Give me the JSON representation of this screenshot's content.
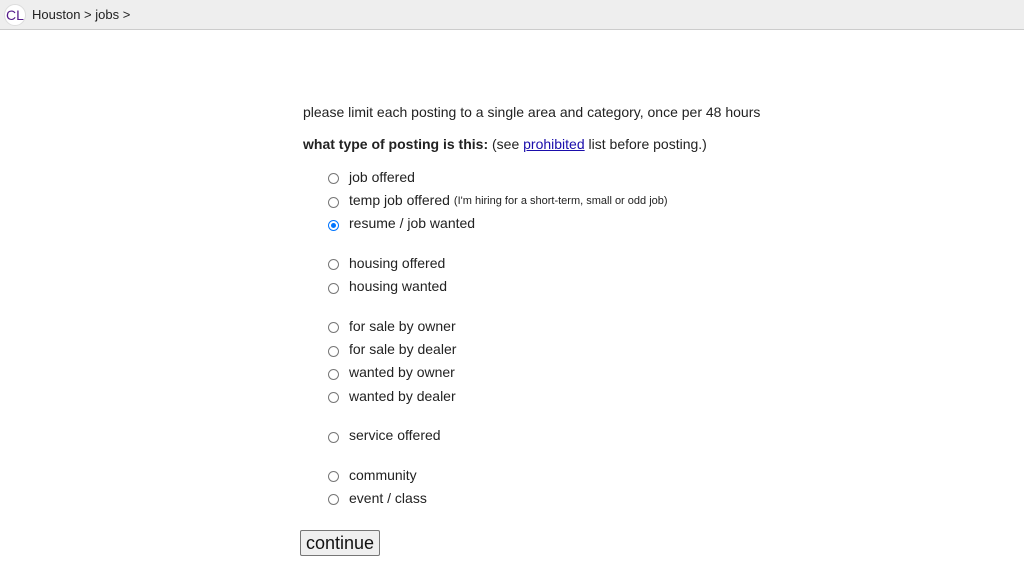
{
  "header": {
    "logo": "CL",
    "breadcrumb": [
      {
        "label": "Houston"
      },
      {
        "label": "jobs"
      }
    ],
    "separator": ">"
  },
  "main": {
    "intro": "please limit each posting to a single area and category, once per 48 hours",
    "question_bold": "what type of posting is this:",
    "question_pre": " (see ",
    "question_link": "prohibited",
    "question_post": " list before posting.)",
    "groups": [
      [
        {
          "label": "job offered",
          "checked": false
        },
        {
          "label": "temp job offered",
          "hint": "(I'm hiring for a short-term, small or odd job)",
          "checked": false
        },
        {
          "label": "resume / job wanted",
          "checked": true
        }
      ],
      [
        {
          "label": "housing offered",
          "checked": false
        },
        {
          "label": "housing wanted",
          "checked": false
        }
      ],
      [
        {
          "label": "for sale by owner",
          "checked": false
        },
        {
          "label": "for sale by dealer",
          "checked": false
        },
        {
          "label": "wanted by owner",
          "checked": false
        },
        {
          "label": "wanted by dealer",
          "checked": false
        }
      ],
      [
        {
          "label": "service offered",
          "checked": false
        }
      ],
      [
        {
          "label": "community",
          "checked": false
        },
        {
          "label": "event / class",
          "checked": false
        }
      ]
    ],
    "continue_label": "continue"
  }
}
